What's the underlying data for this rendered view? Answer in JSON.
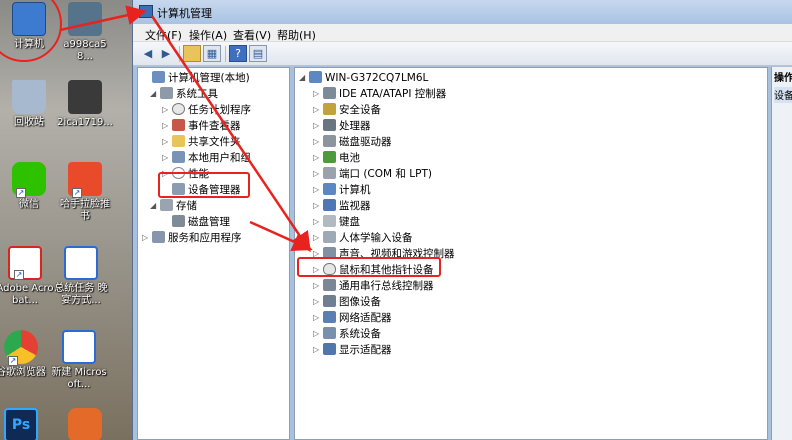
{
  "desktop": {
    "icons": [
      {
        "label": "计算机",
        "icon": "computer-icon",
        "color": "#3d7bd0"
      },
      {
        "label": "a998ca58...",
        "icon": "image-file-icon",
        "color": "#55748c"
      },
      {
        "label": "回收站",
        "icon": "recycle-bin-icon",
        "color": "#a6b9cf"
      },
      {
        "label": "2ica1719...",
        "icon": "video-file-icon",
        "color": "#3a3a3a"
      },
      {
        "label": "微信",
        "icon": "wechat-icon",
        "color": "#2dc100"
      },
      {
        "label": "哈手拉脸推书",
        "icon": "reader-app-icon",
        "color": "#e94a2a"
      },
      {
        "label": "Adobe Acrobat...",
        "icon": "pdf-icon",
        "color": "#d9261c"
      },
      {
        "label": "总统任务 晚宴方式...",
        "icon": "word-doc-icon",
        "color": "#2b6bd6"
      },
      {
        "label": "谷歌浏览器",
        "icon": "chrome-icon",
        "color": "#e44134"
      },
      {
        "label": "新建 Microsoft...",
        "icon": "word-doc-icon",
        "color": "#2b6bd6"
      },
      {
        "label": "Ps",
        "icon": "photoshop-icon",
        "color": "#0f2a54"
      },
      {
        "label": "",
        "icon": "game-app-icon",
        "color": "#e46a2a"
      }
    ]
  },
  "window": {
    "title": "计算机管理",
    "menu": [
      "文件(F)",
      "操作(A)",
      "查看(V)",
      "帮助(H)"
    ],
    "toolbar": [
      "back-icon",
      "forward-icon",
      "up-folder-icon",
      "show-tree-icon",
      "help-icon",
      "view-icon"
    ]
  },
  "left_tree": {
    "items": [
      {
        "label": "计算机管理(本地)",
        "icon": "computer-management-icon",
        "expander": ""
      },
      {
        "label": "系统工具",
        "icon": "tools-icon",
        "expander": "◢"
      },
      {
        "label": "任务计划程序",
        "icon": "clock-icon",
        "expander": "▷"
      },
      {
        "label": "事件查看器",
        "icon": "event-viewer-icon",
        "expander": "▷"
      },
      {
        "label": "共享文件夹",
        "icon": "shared-folder-icon",
        "expander": "▷"
      },
      {
        "label": "本地用户和组",
        "icon": "users-icon",
        "expander": "▷"
      },
      {
        "label": "性能",
        "icon": "performance-icon",
        "expander": "▷"
      },
      {
        "label": "设备管理器",
        "icon": "device-manager-icon",
        "expander": ""
      },
      {
        "label": "存储",
        "icon": "storage-icon",
        "expander": "◢"
      },
      {
        "label": "磁盘管理",
        "icon": "disk-management-icon",
        "expander": ""
      },
      {
        "label": "服务和应用程序",
        "icon": "services-icon",
        "expander": "▷"
      }
    ]
  },
  "right_tree": {
    "root": "WIN-G372CQ7LM6L",
    "items": [
      {
        "label": "IDE ATA/ATAPI 控制器",
        "icon": "ide-controller-icon"
      },
      {
        "label": "安全设备",
        "icon": "security-device-icon"
      },
      {
        "label": "处理器",
        "icon": "processor-icon"
      },
      {
        "label": "磁盘驱动器",
        "icon": "disk-drive-icon"
      },
      {
        "label": "电池",
        "icon": "battery-icon"
      },
      {
        "label": "端口 (COM 和 LPT)",
        "icon": "port-icon"
      },
      {
        "label": "计算机",
        "icon": "computer-icon"
      },
      {
        "label": "监视器",
        "icon": "monitor-icon"
      },
      {
        "label": "键盘",
        "icon": "keyboard-icon"
      },
      {
        "label": "人体学输入设备",
        "icon": "hid-icon"
      },
      {
        "label": "声音、视频和游戏控制器",
        "icon": "audio-icon"
      },
      {
        "label": "鼠标和其他指针设备",
        "icon": "mouse-icon"
      },
      {
        "label": "通用串行总线控制器",
        "icon": "usb-icon"
      },
      {
        "label": "图像设备",
        "icon": "imaging-icon"
      },
      {
        "label": "网络适配器",
        "icon": "network-adapter-icon"
      },
      {
        "label": "系统设备",
        "icon": "system-device-icon"
      },
      {
        "label": "显示适配器",
        "icon": "display-adapter-icon"
      }
    ]
  },
  "action_pane": {
    "header": "操作",
    "sub": "设备"
  },
  "colors": {
    "annotation": "#e8231f",
    "title_bar": "#b8cfea",
    "tree_icon": "#5b87c2"
  }
}
